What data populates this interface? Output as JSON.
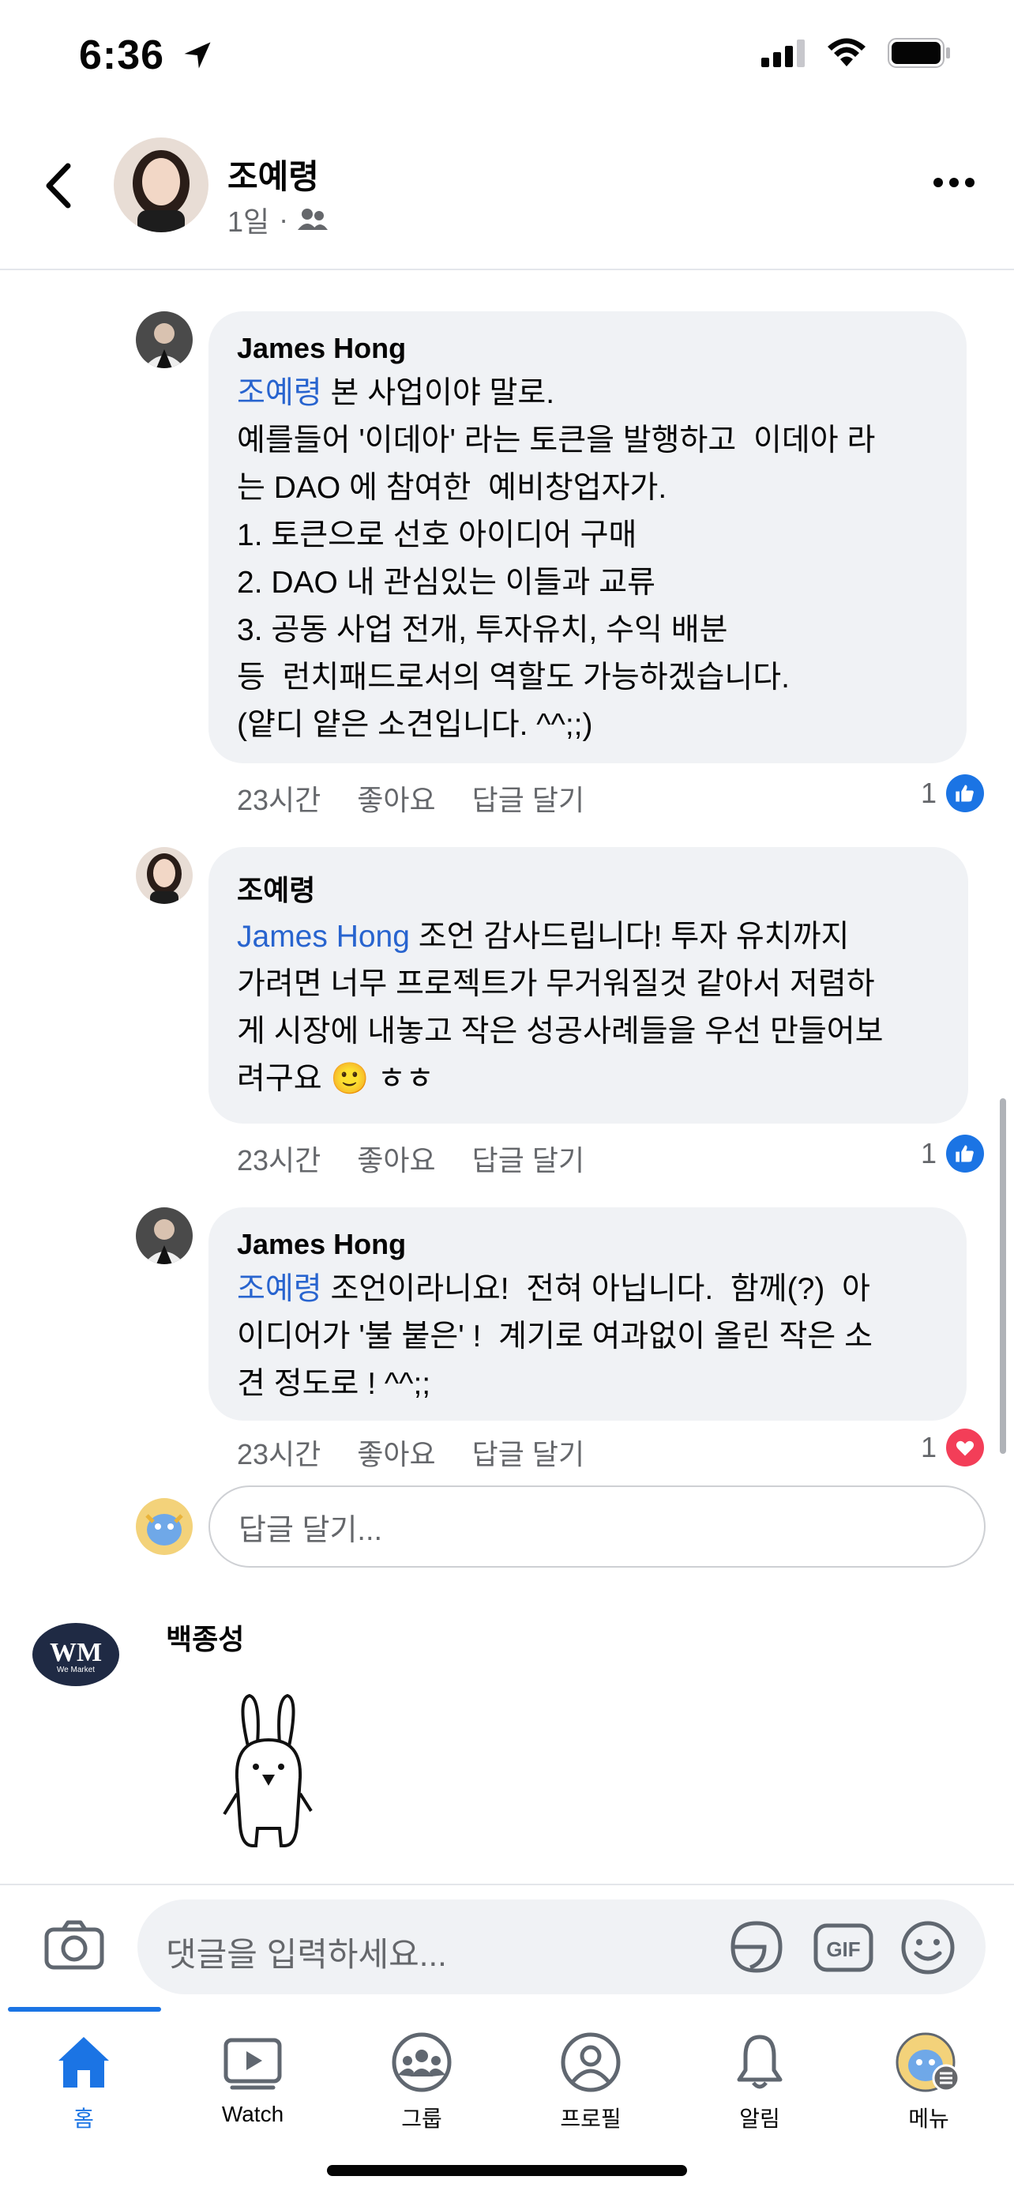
{
  "status": {
    "time": "6:36"
  },
  "post": {
    "author": "조예령",
    "age": "1일",
    "audience_icon": "friends-icon"
  },
  "comments": [
    {
      "author": "James Hong",
      "mention": "조예령",
      "text": " 본 사업이야 말로.\n예를들어 '이데아' 라는 토큰을 발행하고  이데아 라\n는 DAO 에 참여한  예비창업자가.\n1. 토큰으로 선호 아이디어 구매\n2. DAO 내 관심있는 이들과 교류\n3. 공동 사업 전개, 투자유치, 수익 배분\n등  런치패드로서의 역할도 가능하겠습니다.\n(얕디 얕은 소견입니다. ^^;;)",
      "time": "23시간",
      "like": "좋아요",
      "reply": "답글 달기",
      "reaction_count": "1",
      "reaction": "like"
    },
    {
      "author": "조예령",
      "mention": "James Hong",
      "text": " 조언 감사드립니다! 투자 유치까지\n가려면 너무 프로젝트가 무거워질것 같아서 저렴하\n게 시장에 내놓고 작은 성공사례들을 우선 만들어보\n려구요 🙂 ㅎㅎ",
      "time": "23시간",
      "like": "좋아요",
      "reply": "답글 달기",
      "reaction_count": "1",
      "reaction": "like"
    },
    {
      "author": "James Hong",
      "mention": "조예령",
      "text": " 조언이라니요!  전혀 아닙니다.  함께(?)  아\n이디어가 '불 붙은' !  계기로 여과없이 올린 작은 소\n견 정도로 ! ^^;;",
      "time": "23시간",
      "like": "좋아요",
      "reply": "답글 달기",
      "reaction_count": "1",
      "reaction": "love"
    }
  ],
  "reply_input": {
    "placeholder": "답글 달기..."
  },
  "next_comment": {
    "author": "백종성",
    "avatar_text": "We Market"
  },
  "composer": {
    "placeholder": "댓글을 입력하세요..."
  },
  "tabs": [
    {
      "label": "홈",
      "icon": "home-icon",
      "active": true
    },
    {
      "label": "Watch",
      "icon": "watch-icon"
    },
    {
      "label": "그룹",
      "icon": "groups-icon"
    },
    {
      "label": "프로필",
      "icon": "profile-icon"
    },
    {
      "label": "알림",
      "icon": "bell-icon"
    },
    {
      "label": "메뉴",
      "icon": "menu-avatar-icon"
    }
  ],
  "colors": {
    "accent": "#1b74e4",
    "mention": "#2864cf",
    "bubble": "#f0f2f5",
    "love": "#f33e58"
  }
}
